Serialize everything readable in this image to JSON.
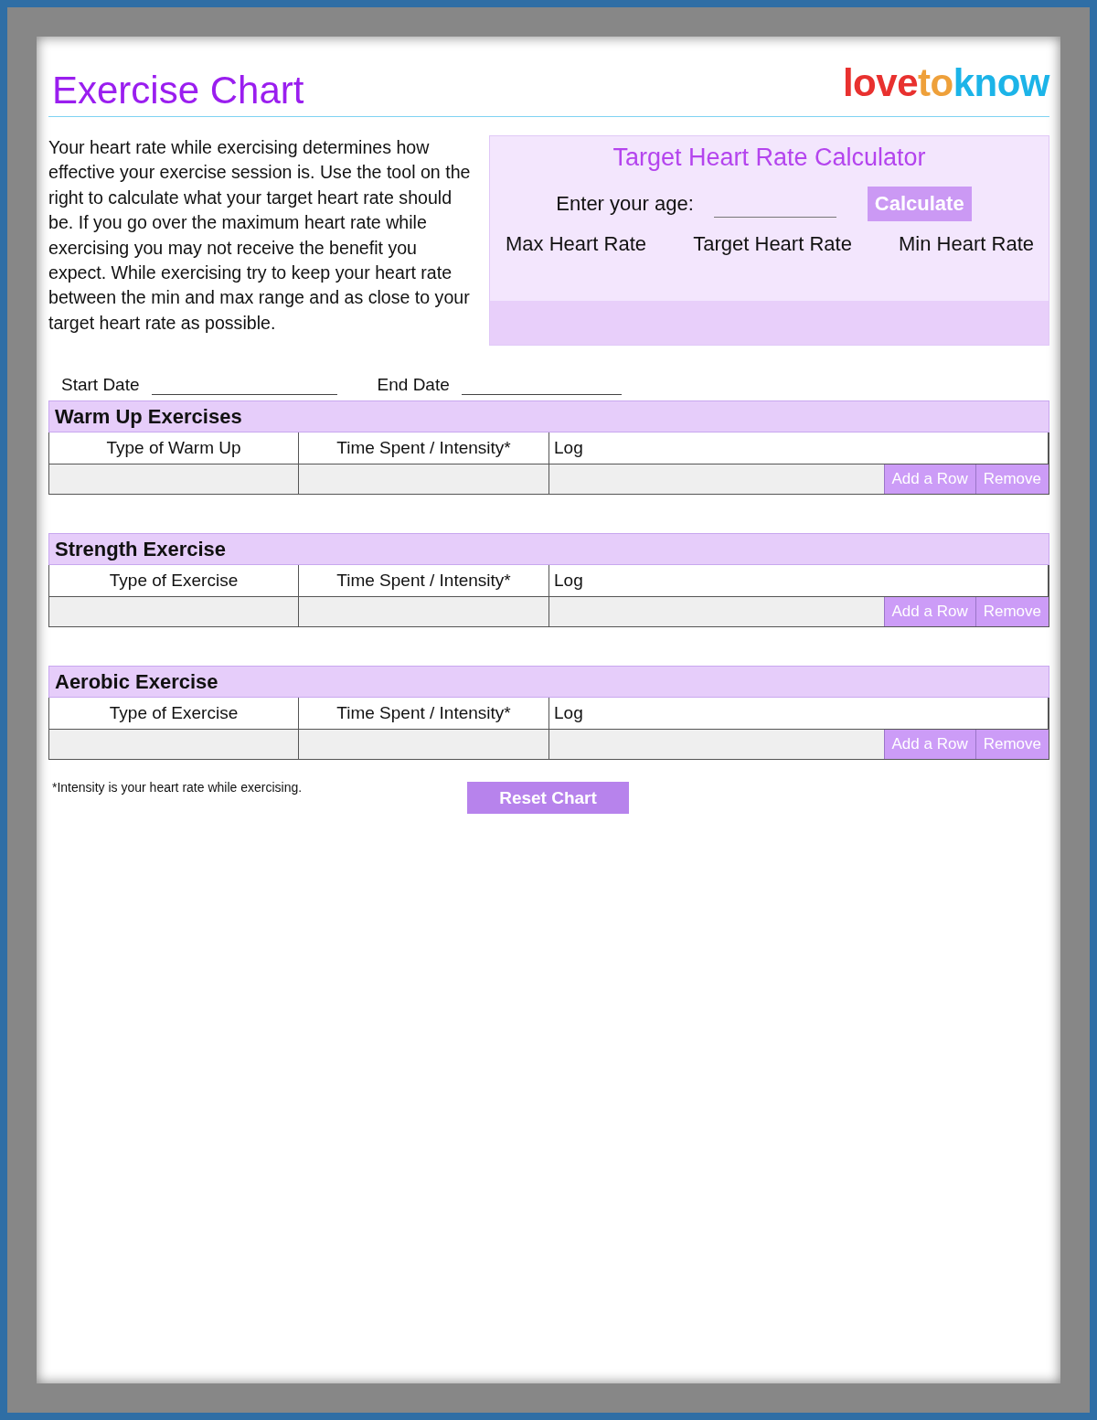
{
  "header": {
    "title": "Exercise Chart",
    "logo": [
      {
        "text": "love",
        "color": "#e8312f"
      },
      {
        "text": "to",
        "color": "#eea03a"
      },
      {
        "text": "know",
        "color": "#1cb4e8"
      }
    ]
  },
  "intro": "Your heart rate while exercising determines how effective your exercise session is. Use the tool on the right to calculate what your target heart rate should be. If you go over the maximum heart rate while exercising you may not receive the benefit you expect. While exercising try to keep your heart rate between the min and max range and as close to your target heart rate as possible.",
  "calculator": {
    "title": "Target Heart Rate Calculator",
    "age_label": "Enter your age:",
    "button": "Calculate",
    "results": [
      "Max Heart Rate",
      "Target Heart Rate",
      "Min Heart Rate"
    ]
  },
  "dates": {
    "start_label": "Start Date",
    "end_label": "End Date"
  },
  "sections": [
    {
      "title": "Warm Up Exercises",
      "columns": [
        "Type of Warm Up",
        "Time Spent / Intensity*",
        "Log"
      ],
      "buttons": [
        "Add a Row",
        "Remove"
      ]
    },
    {
      "title": "Strength Exercise",
      "columns": [
        "Type of Exercise",
        "Time Spent / Intensity*",
        "Log"
      ],
      "buttons": [
        "Add a Row",
        "Remove"
      ]
    },
    {
      "title": "Aerobic Exercise",
      "columns": [
        "Type of Exercise",
        "Time Spent / Intensity*",
        "Log"
      ],
      "buttons": [
        "Add a Row",
        "Remove"
      ]
    }
  ],
  "footnote": "*Intensity is your heart rate while exercising.",
  "reset_button": "Reset Chart"
}
